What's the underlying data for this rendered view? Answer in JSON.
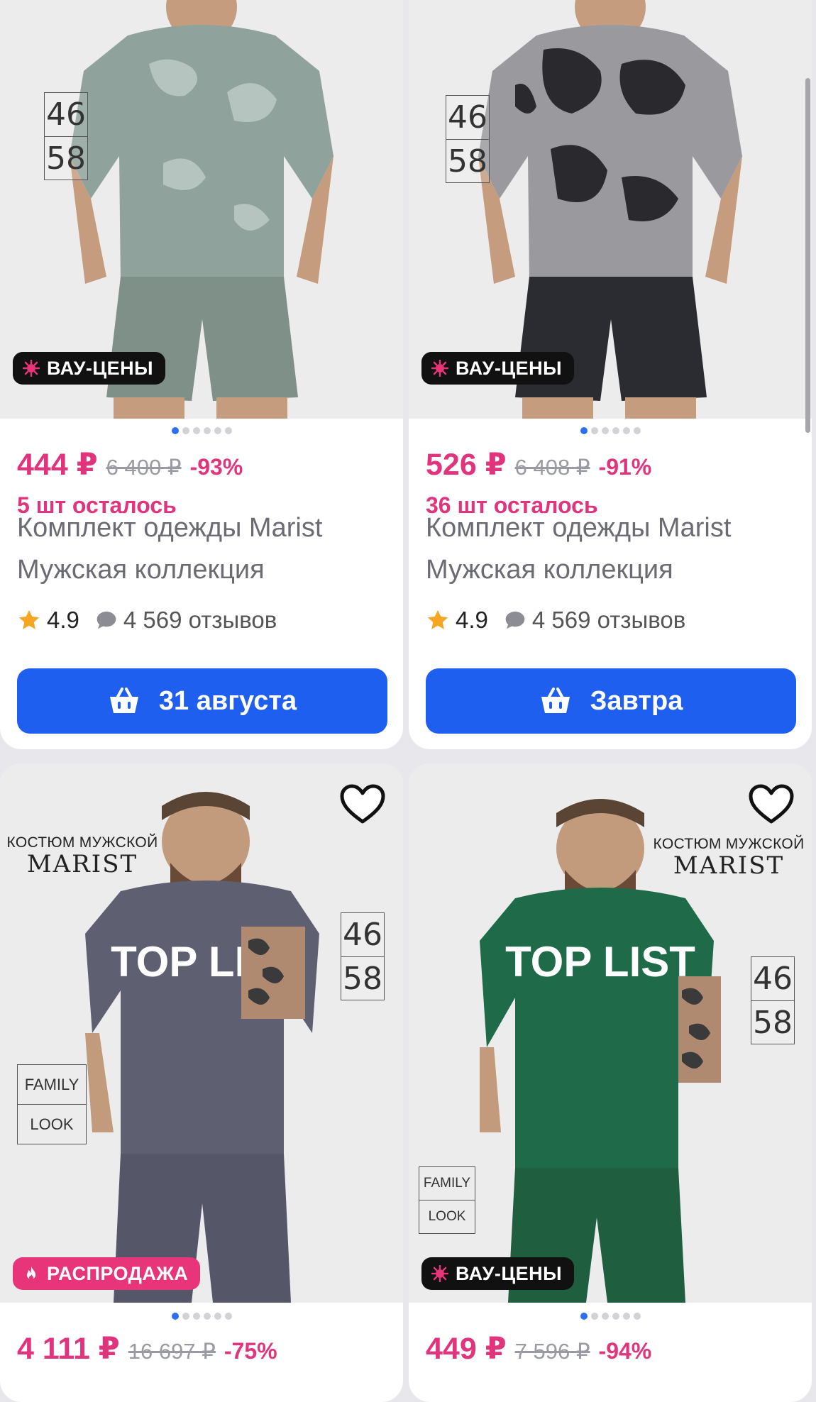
{
  "products": [
    {
      "badge": "ВАУ-ЦЕНЫ",
      "badge_icon": "sparkle-icon",
      "sizes": [
        "46",
        "58"
      ],
      "price": "444 ₽",
      "old_price": "6 400 ₽",
      "discount": "-93%",
      "stock": "5 шт осталось",
      "title": "Комплект одежды Marist Мужская коллекция",
      "rating": "4.9",
      "reviews": "4 569 отзывов",
      "cart_label": "31 августа",
      "shirt_color": "#8fa29b",
      "shorts_color": "#7f9088"
    },
    {
      "badge": "ВАУ-ЦЕНЫ",
      "badge_icon": "sparkle-icon",
      "sizes": [
        "46",
        "58"
      ],
      "price": "526 ₽",
      "old_price": "6 408 ₽",
      "discount": "-91%",
      "stock": "36 шт осталось",
      "title": "Комплект одежды Marist Мужская коллекция",
      "rating": "4.9",
      "reviews": "4 569 отзывов",
      "cart_label": "Завтра",
      "shirt_color": "#5a5a5e",
      "shorts_color": "#2b2c31"
    },
    {
      "brand_text": "КОСТЮМ МУЖСКОЙ",
      "brand_mark": "MARIST",
      "sizes": [
        "46",
        "58"
      ],
      "family": [
        "FAMILY",
        "LOOK"
      ],
      "badge": "РАСПРОДАЖА",
      "badge_icon": "flame-icon",
      "price": "4 111 ₽",
      "old_price": "16 697 ₽",
      "discount": "-75%",
      "shirt_color": "#5f5f72",
      "shorts_color": "#565669"
    },
    {
      "brand_text": "КОСТЮМ МУЖСКОЙ",
      "brand_mark": "MARIST",
      "sizes": [
        "46",
        "58"
      ],
      "family": [
        "FAMILY",
        "LOOK"
      ],
      "badge": "ВАУ-ЦЕНЫ",
      "badge_icon": "sparkle-icon",
      "price": "449 ₽",
      "old_price": "7 596 ₽",
      "discount": "-94%",
      "shirt_color": "#1f6a48",
      "shorts_color": "#1f5f40"
    }
  ],
  "colors": {
    "accent_pink": "#e0357c",
    "button_blue": "#1f5ff0",
    "badge_dark": "#111111",
    "badge_sale": "#e8357a",
    "star": "#f5a623",
    "dot_active": "#2e6ff0"
  }
}
